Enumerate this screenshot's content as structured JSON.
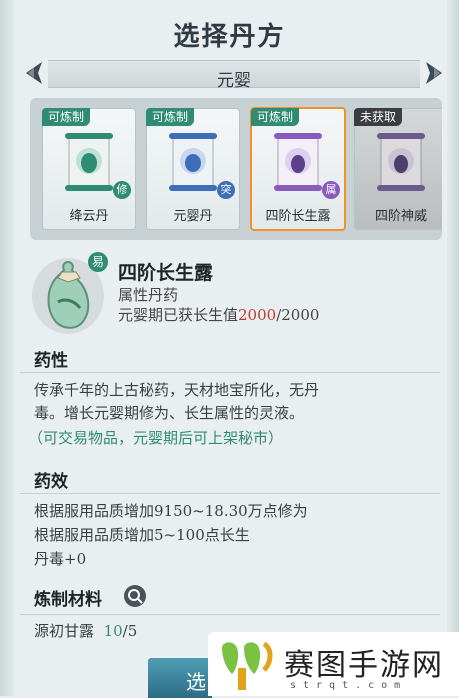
{
  "header": {
    "title": "选择丹方",
    "tier": "元婴"
  },
  "cards": [
    {
      "tag": "可炼制",
      "name": "绛云丹",
      "badge": "修",
      "badge_color": "#2f8c73",
      "scroll_color": "#2f8c73"
    },
    {
      "tag": "可炼制",
      "name": "元婴丹",
      "badge": "突",
      "badge_color": "#3d6fb8",
      "scroll_color": "#3d6fb8"
    },
    {
      "tag": "可炼制",
      "name": "四阶长生露",
      "badge": "属",
      "badge_color": "#8a5bbf",
      "scroll_color": "#8a5bbf",
      "selected": true
    },
    {
      "tag": "未获取",
      "name": "四阶神威",
      "badge": "",
      "badge_color": "#8a5bbf",
      "scroll_color": "#6b5a8c",
      "locked": true
    }
  ],
  "detail": {
    "difficulty": "易",
    "name": "四阶长生露",
    "type": "属性丹药",
    "gain_prefix": "元婴期已获长生值",
    "gain_current": "2000",
    "gain_sep": "/",
    "gain_max": "2000"
  },
  "properties": {
    "title": "药性",
    "line1": "传承千年的上古秘药，天材地宝所化，无丹",
    "line2": "毒。增长元婴期修为、长生属性的灵液。",
    "note": "（可交易物品，元婴期后可上架秘市）"
  },
  "effects": {
    "title": "药效",
    "line1": "根据服用品质增加9150~18.30万点修为",
    "line2": "根据服用品质增加5~100点长生",
    "line3": "丹毒+0"
  },
  "materials": {
    "title": "炼制材料",
    "items": [
      {
        "name": "源初甘露",
        "have": "10",
        "sep": "/",
        "need": "5"
      }
    ]
  },
  "confirm_button": {
    "label": "选"
  },
  "watermark": {
    "text": "赛图手游网",
    "url": "strqt.com"
  }
}
